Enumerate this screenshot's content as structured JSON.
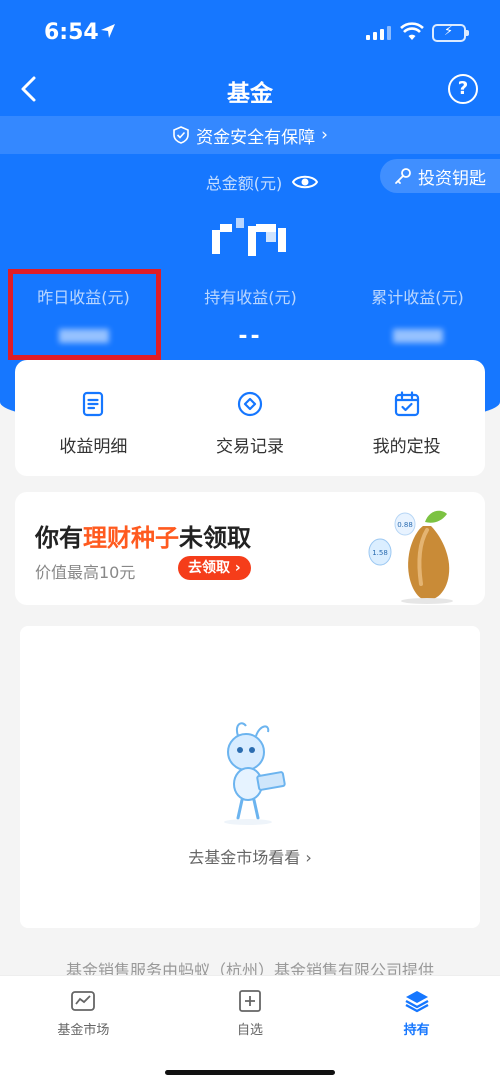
{
  "status_bar": {
    "time": "6:54"
  },
  "nav": {
    "title": "基金",
    "help_label": "?"
  },
  "safety_banner": {
    "text": "资金安全有保障",
    "chevron": "›"
  },
  "invest_key": {
    "label": "投资钥匙"
  },
  "total": {
    "label": "总金额(元)"
  },
  "stats": [
    {
      "label": "昨日收益(元)",
      "value": ""
    },
    {
      "label": "持有收益(元)",
      "value": "--"
    },
    {
      "label": "累计收益(元)",
      "value": ""
    }
  ],
  "quick_actions": [
    {
      "label": "收益明细",
      "icon": "document-icon"
    },
    {
      "label": "交易记录",
      "icon": "diamond-circle-icon"
    },
    {
      "label": "我的定投",
      "icon": "calendar-check-icon"
    }
  ],
  "promo": {
    "title_prefix": "你有",
    "title_highlight": "理财种子",
    "title_suffix": "未领取",
    "subtitle": "价值最高10元",
    "button": "去领取 ›",
    "drop_values": [
      "1.58",
      "0.88"
    ]
  },
  "empty_state": {
    "link": "去基金市场看看 ›"
  },
  "footer_note": "基金销售服务由蚂蚁（杭州）基金销售有限公司提供",
  "tabs": [
    {
      "label": "基金市场",
      "icon": "market-icon",
      "active": false
    },
    {
      "label": "自选",
      "icon": "add-square-icon",
      "active": false
    },
    {
      "label": "持有",
      "icon": "layers-icon",
      "active": true
    }
  ],
  "colors": {
    "primary": "#1677ff",
    "accent": "#ff5a1f",
    "highlight_box": "#e11d27"
  }
}
